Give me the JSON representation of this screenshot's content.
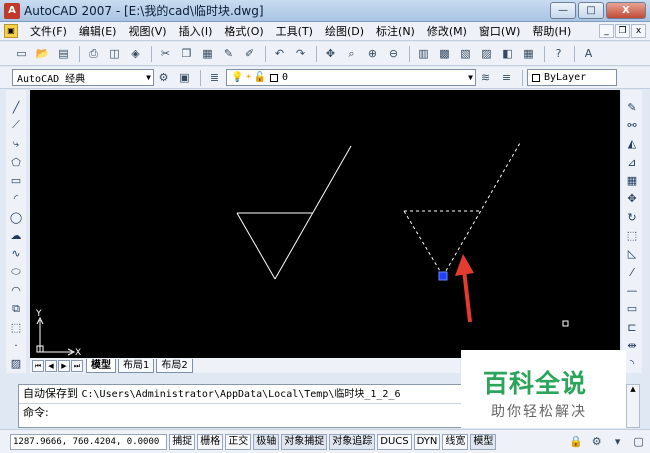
{
  "window": {
    "title": "AutoCAD 2007 - [E:\\我的cad\\临时块.dwg]",
    "app_icon": "autocad-logo-icon",
    "minimize": "—",
    "maximize": "□",
    "close": "X"
  },
  "menu": {
    "items": [
      "文件(F)",
      "编辑(E)",
      "视图(V)",
      "插入(I)",
      "格式(O)",
      "工具(T)",
      "绘图(D)",
      "标注(N)",
      "修改(M)",
      "窗口(W)",
      "帮助(H)"
    ],
    "doc_min": "_",
    "doc_restore": "❐",
    "doc_close": "x"
  },
  "toolbar_standard": {
    "icons": [
      "new-icon",
      "open-icon",
      "save-icon",
      "print-icon",
      "preview-icon",
      "publish-icon",
      "cut-icon",
      "copy-icon",
      "paste-icon",
      "match-icon",
      "brush-icon",
      "undo-icon",
      "redo-icon",
      "pan-icon",
      "zoom-realtime-icon",
      "zoom-window-icon",
      "zoom-previous-icon",
      "properties-icon",
      "design-center-icon",
      "tool-palettes-icon",
      "sheet-set-icon",
      "markup-icon",
      "calculator-icon",
      "help-icon",
      "text-style-icon"
    ]
  },
  "toolbar_properties": {
    "workspace": "AutoCAD 经典",
    "layer_value": "0",
    "color_value": "ByLayer"
  },
  "drawing": {
    "background": "#000000",
    "line_color": "#ffffff",
    "grip_color": "#1e40ff",
    "arrow_color": "#e33b2e",
    "ucs_x": "X",
    "ucs_y": "Y"
  },
  "layout_tabs": {
    "tabs": [
      "模型",
      "布局1",
      "布局2"
    ],
    "active": "模型"
  },
  "command": {
    "line1_label": "自动保存到",
    "line1_path": "C:\\Users\\Administrator\\AppData\\Local\\Temp\\临时块_1_2_6",
    "line2_prompt": "命令:"
  },
  "status": {
    "coords": "1287.9666, 760.4204, 0.0000",
    "toggles": [
      "捕捉",
      "栅格",
      "正交",
      "极轴",
      "对象捕捉",
      "对象追踪",
      "DUCS",
      "DYN",
      "线宽",
      "模型"
    ]
  },
  "watermark": {
    "title": "百科全说",
    "subtitle": "助你轻松解决",
    "color": "#2aa55a"
  }
}
